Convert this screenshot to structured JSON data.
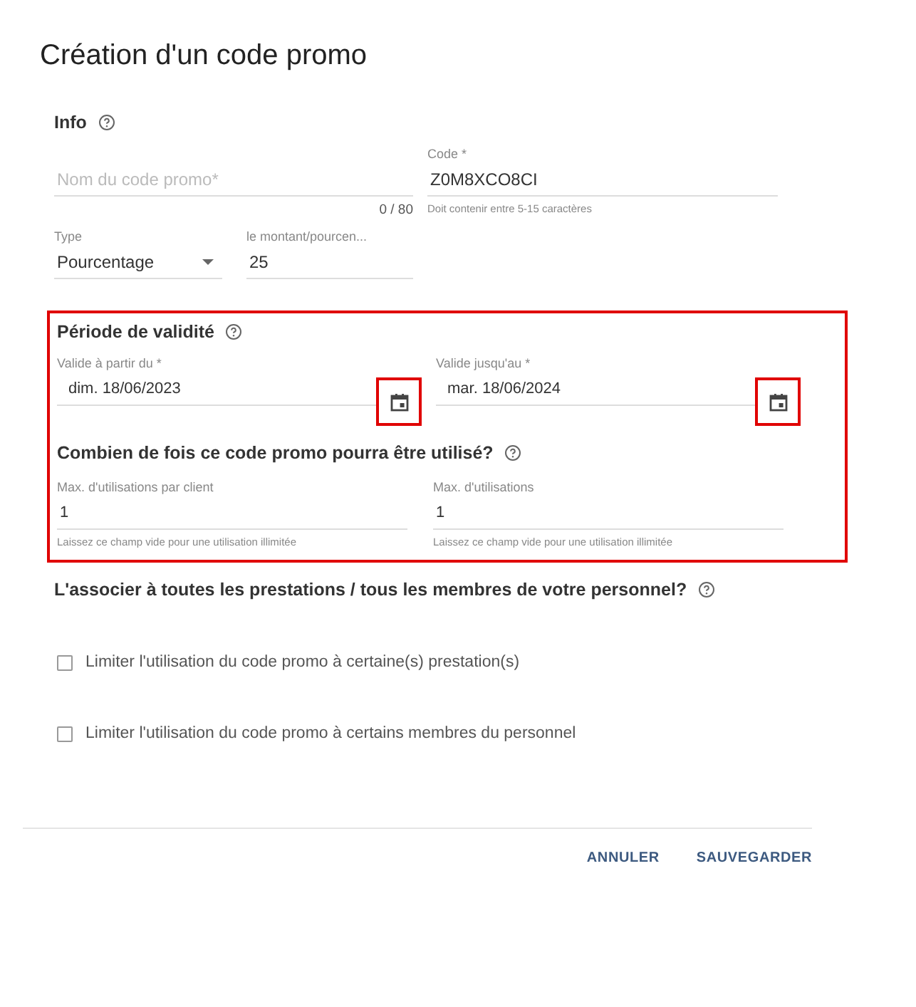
{
  "title": "Création d'un code promo",
  "info": {
    "heading": "Info",
    "name_field": {
      "placeholder": "Nom du code promo*",
      "counter": "0 / 80"
    },
    "code_field": {
      "label": "Code *",
      "value": "Z0M8XCO8CI",
      "hint": "Doit contenir entre 5-15 caractères"
    },
    "type_field": {
      "label": "Type",
      "value": "Pourcentage"
    },
    "amount_field": {
      "label": "le montant/pourcen...",
      "value": "25"
    }
  },
  "validity": {
    "highlighted": true,
    "heading": "Période de validité",
    "dates": [
      {
        "label": "Valide à partir du *",
        "value": "dim. 18/06/2023",
        "highlighted": true
      },
      {
        "label": "Valide jusqu'au *",
        "value": "mar. 18/06/2024",
        "highlighted": true
      }
    ],
    "usage_heading": "Combien de fois ce code promo pourra être utilisé?",
    "usage": [
      {
        "label": "Max. d'utilisations par client",
        "value": "1",
        "hint": "Laissez ce champ vide pour une utilisation illimitée"
      },
      {
        "label": "Max. d'utilisations",
        "value": "1",
        "hint": "Laissez ce champ vide pour une utilisation illimitée"
      }
    ]
  },
  "association": {
    "heading": "L'associer à toutes les prestations / tous les membres de votre personnel?",
    "options": [
      {
        "label": "Limiter l'utilisation du code promo à certaine(s) prestation(s)",
        "checked": false
      },
      {
        "label": "Limiter l'utilisation du code promo à certains membres du personnel",
        "checked": false
      }
    ]
  },
  "buttons": [
    "ANNULER",
    "SAUVEGARDER"
  ]
}
